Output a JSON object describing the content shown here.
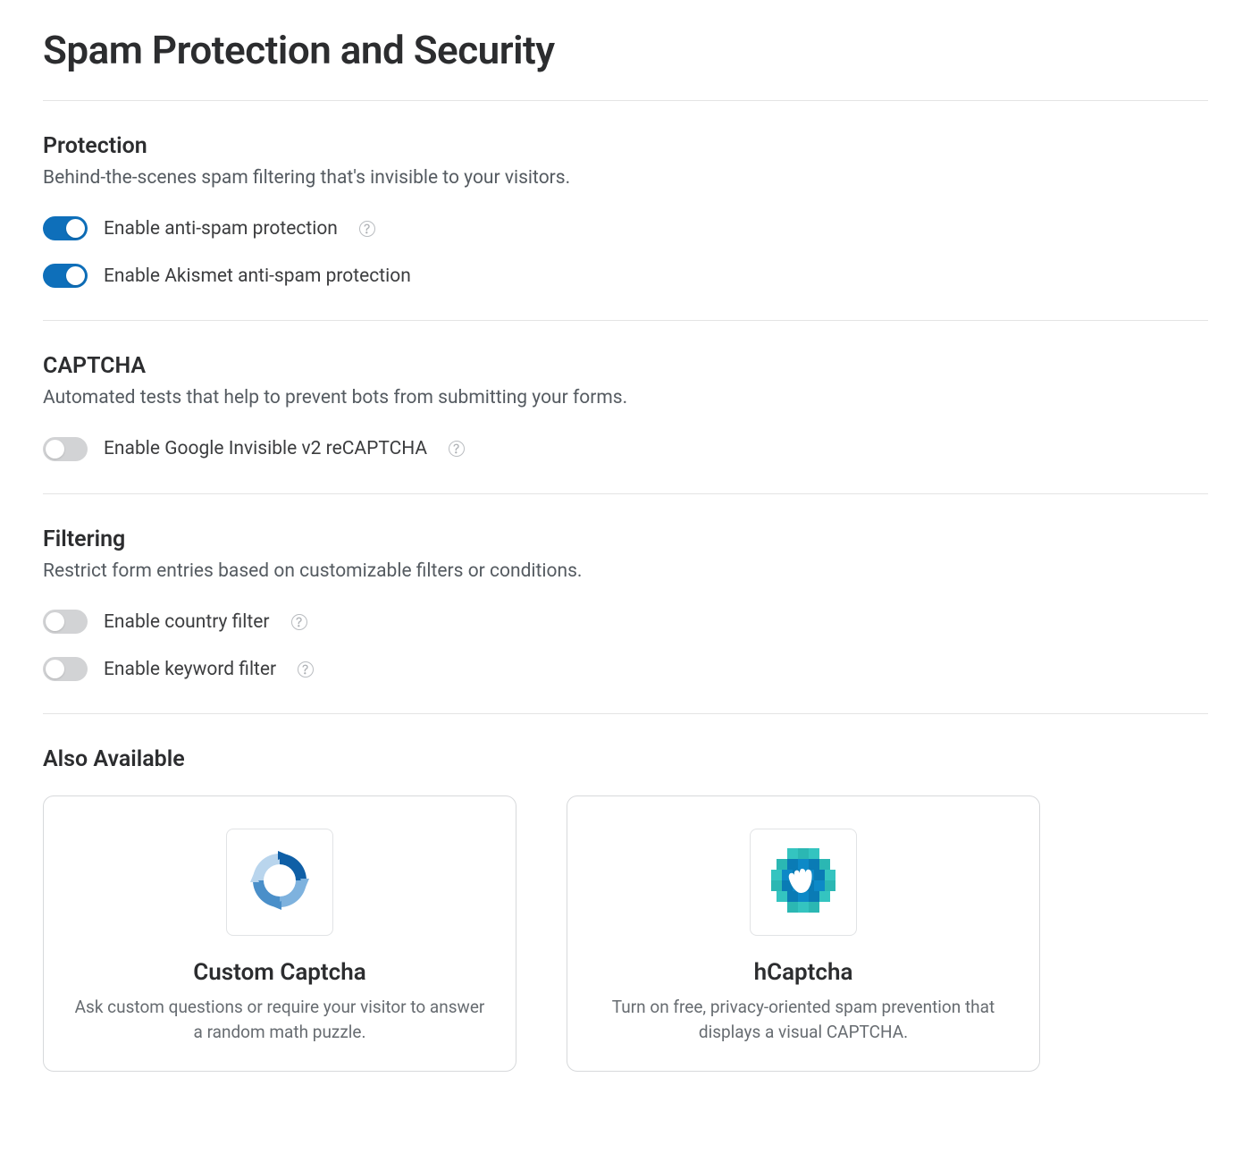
{
  "page": {
    "title": "Spam Protection and Security"
  },
  "sections": {
    "protection": {
      "title": "Protection",
      "desc": "Behind-the-scenes spam filtering that's invisible to your visitors.",
      "toggles": [
        {
          "label": "Enable anti-spam protection",
          "on": true,
          "help": true
        },
        {
          "label": "Enable Akismet anti-spam protection",
          "on": true,
          "help": false
        }
      ]
    },
    "captcha": {
      "title": "CAPTCHA",
      "desc": "Automated tests that help to prevent bots from submitting your forms.",
      "toggles": [
        {
          "label": "Enable Google Invisible v2 reCAPTCHA",
          "on": false,
          "help": true
        }
      ]
    },
    "filtering": {
      "title": "Filtering",
      "desc": "Restrict form entries based on customizable filters or conditions.",
      "toggles": [
        {
          "label": "Enable country filter",
          "on": false,
          "help": true
        },
        {
          "label": "Enable keyword filter",
          "on": false,
          "help": true
        }
      ]
    },
    "also": {
      "title": "Also Available",
      "cards": [
        {
          "icon": "cycle-icon",
          "title": "Custom Captcha",
          "desc": "Ask custom questions or require your visitor to answer a random math puzzle."
        },
        {
          "icon": "hcaptcha-icon",
          "title": "hCaptcha",
          "desc": "Turn on free, privacy-oriented spam prevention that displays a visual CAPTCHA."
        }
      ]
    }
  },
  "colors": {
    "toggle_on": "#0e6fba",
    "toggle_off": "#d2d3d5",
    "text_primary": "#2c2d2f",
    "text_secondary": "#555b61",
    "border": "#e4e4e4"
  }
}
